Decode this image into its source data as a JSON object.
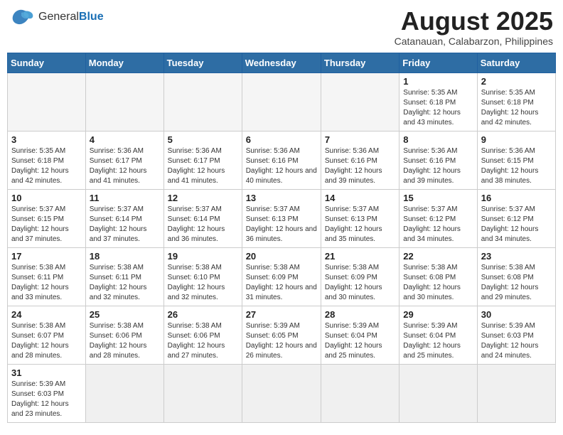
{
  "header": {
    "logo_general": "General",
    "logo_blue": "Blue",
    "month_year": "August 2025",
    "location": "Catanauan, Calabarzon, Philippines"
  },
  "days_of_week": [
    "Sunday",
    "Monday",
    "Tuesday",
    "Wednesday",
    "Thursday",
    "Friday",
    "Saturday"
  ],
  "weeks": [
    [
      {
        "day": "",
        "info": ""
      },
      {
        "day": "",
        "info": ""
      },
      {
        "day": "",
        "info": ""
      },
      {
        "day": "",
        "info": ""
      },
      {
        "day": "",
        "info": ""
      },
      {
        "day": "1",
        "info": "Sunrise: 5:35 AM\nSunset: 6:18 PM\nDaylight: 12 hours and 43 minutes."
      },
      {
        "day": "2",
        "info": "Sunrise: 5:35 AM\nSunset: 6:18 PM\nDaylight: 12 hours and 42 minutes."
      }
    ],
    [
      {
        "day": "3",
        "info": "Sunrise: 5:35 AM\nSunset: 6:18 PM\nDaylight: 12 hours and 42 minutes."
      },
      {
        "day": "4",
        "info": "Sunrise: 5:36 AM\nSunset: 6:17 PM\nDaylight: 12 hours and 41 minutes."
      },
      {
        "day": "5",
        "info": "Sunrise: 5:36 AM\nSunset: 6:17 PM\nDaylight: 12 hours and 41 minutes."
      },
      {
        "day": "6",
        "info": "Sunrise: 5:36 AM\nSunset: 6:16 PM\nDaylight: 12 hours and 40 minutes."
      },
      {
        "day": "7",
        "info": "Sunrise: 5:36 AM\nSunset: 6:16 PM\nDaylight: 12 hours and 39 minutes."
      },
      {
        "day": "8",
        "info": "Sunrise: 5:36 AM\nSunset: 6:16 PM\nDaylight: 12 hours and 39 minutes."
      },
      {
        "day": "9",
        "info": "Sunrise: 5:36 AM\nSunset: 6:15 PM\nDaylight: 12 hours and 38 minutes."
      }
    ],
    [
      {
        "day": "10",
        "info": "Sunrise: 5:37 AM\nSunset: 6:15 PM\nDaylight: 12 hours and 37 minutes."
      },
      {
        "day": "11",
        "info": "Sunrise: 5:37 AM\nSunset: 6:14 PM\nDaylight: 12 hours and 37 minutes."
      },
      {
        "day": "12",
        "info": "Sunrise: 5:37 AM\nSunset: 6:14 PM\nDaylight: 12 hours and 36 minutes."
      },
      {
        "day": "13",
        "info": "Sunrise: 5:37 AM\nSunset: 6:13 PM\nDaylight: 12 hours and 36 minutes."
      },
      {
        "day": "14",
        "info": "Sunrise: 5:37 AM\nSunset: 6:13 PM\nDaylight: 12 hours and 35 minutes."
      },
      {
        "day": "15",
        "info": "Sunrise: 5:37 AM\nSunset: 6:12 PM\nDaylight: 12 hours and 34 minutes."
      },
      {
        "day": "16",
        "info": "Sunrise: 5:37 AM\nSunset: 6:12 PM\nDaylight: 12 hours and 34 minutes."
      }
    ],
    [
      {
        "day": "17",
        "info": "Sunrise: 5:38 AM\nSunset: 6:11 PM\nDaylight: 12 hours and 33 minutes."
      },
      {
        "day": "18",
        "info": "Sunrise: 5:38 AM\nSunset: 6:11 PM\nDaylight: 12 hours and 32 minutes."
      },
      {
        "day": "19",
        "info": "Sunrise: 5:38 AM\nSunset: 6:10 PM\nDaylight: 12 hours and 32 minutes."
      },
      {
        "day": "20",
        "info": "Sunrise: 5:38 AM\nSunset: 6:09 PM\nDaylight: 12 hours and 31 minutes."
      },
      {
        "day": "21",
        "info": "Sunrise: 5:38 AM\nSunset: 6:09 PM\nDaylight: 12 hours and 30 minutes."
      },
      {
        "day": "22",
        "info": "Sunrise: 5:38 AM\nSunset: 6:08 PM\nDaylight: 12 hours and 30 minutes."
      },
      {
        "day": "23",
        "info": "Sunrise: 5:38 AM\nSunset: 6:08 PM\nDaylight: 12 hours and 29 minutes."
      }
    ],
    [
      {
        "day": "24",
        "info": "Sunrise: 5:38 AM\nSunset: 6:07 PM\nDaylight: 12 hours and 28 minutes."
      },
      {
        "day": "25",
        "info": "Sunrise: 5:38 AM\nSunset: 6:06 PM\nDaylight: 12 hours and 28 minutes."
      },
      {
        "day": "26",
        "info": "Sunrise: 5:38 AM\nSunset: 6:06 PM\nDaylight: 12 hours and 27 minutes."
      },
      {
        "day": "27",
        "info": "Sunrise: 5:39 AM\nSunset: 6:05 PM\nDaylight: 12 hours and 26 minutes."
      },
      {
        "day": "28",
        "info": "Sunrise: 5:39 AM\nSunset: 6:04 PM\nDaylight: 12 hours and 25 minutes."
      },
      {
        "day": "29",
        "info": "Sunrise: 5:39 AM\nSunset: 6:04 PM\nDaylight: 12 hours and 25 minutes."
      },
      {
        "day": "30",
        "info": "Sunrise: 5:39 AM\nSunset: 6:03 PM\nDaylight: 12 hours and 24 minutes."
      }
    ],
    [
      {
        "day": "31",
        "info": "Sunrise: 5:39 AM\nSunset: 6:03 PM\nDaylight: 12 hours and 23 minutes."
      },
      {
        "day": "",
        "info": ""
      },
      {
        "day": "",
        "info": ""
      },
      {
        "day": "",
        "info": ""
      },
      {
        "day": "",
        "info": ""
      },
      {
        "day": "",
        "info": ""
      },
      {
        "day": "",
        "info": ""
      }
    ]
  ]
}
